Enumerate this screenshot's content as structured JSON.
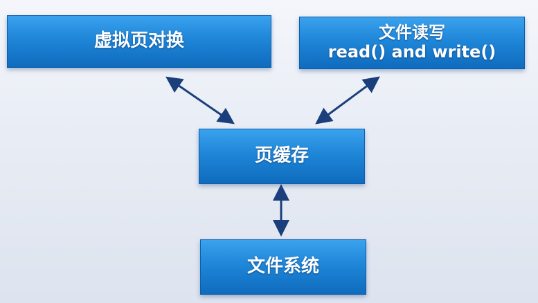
{
  "diagram": {
    "nodes": {
      "virtual_memory_swap": {
        "label": "虚拟页对换"
      },
      "file_rw": {
        "lines": [
          "文件读写",
          "read() and write()"
        ]
      },
      "page_cache": {
        "label": "页缓存"
      },
      "file_system": {
        "label": "文件系统"
      }
    },
    "edges": [
      {
        "from": "virtual_memory_swap",
        "to": "page_cache",
        "direction": "bidirectional"
      },
      {
        "from": "file_rw",
        "to": "page_cache",
        "direction": "bidirectional"
      },
      {
        "from": "page_cache",
        "to": "file_system",
        "direction": "bidirectional"
      }
    ],
    "colors": {
      "box_top": "#3aa2ee",
      "box_bottom": "#0f6bbd",
      "box_text": "#ffffff",
      "arrow": "#1a3f7a",
      "background": "#e9edf5"
    }
  }
}
